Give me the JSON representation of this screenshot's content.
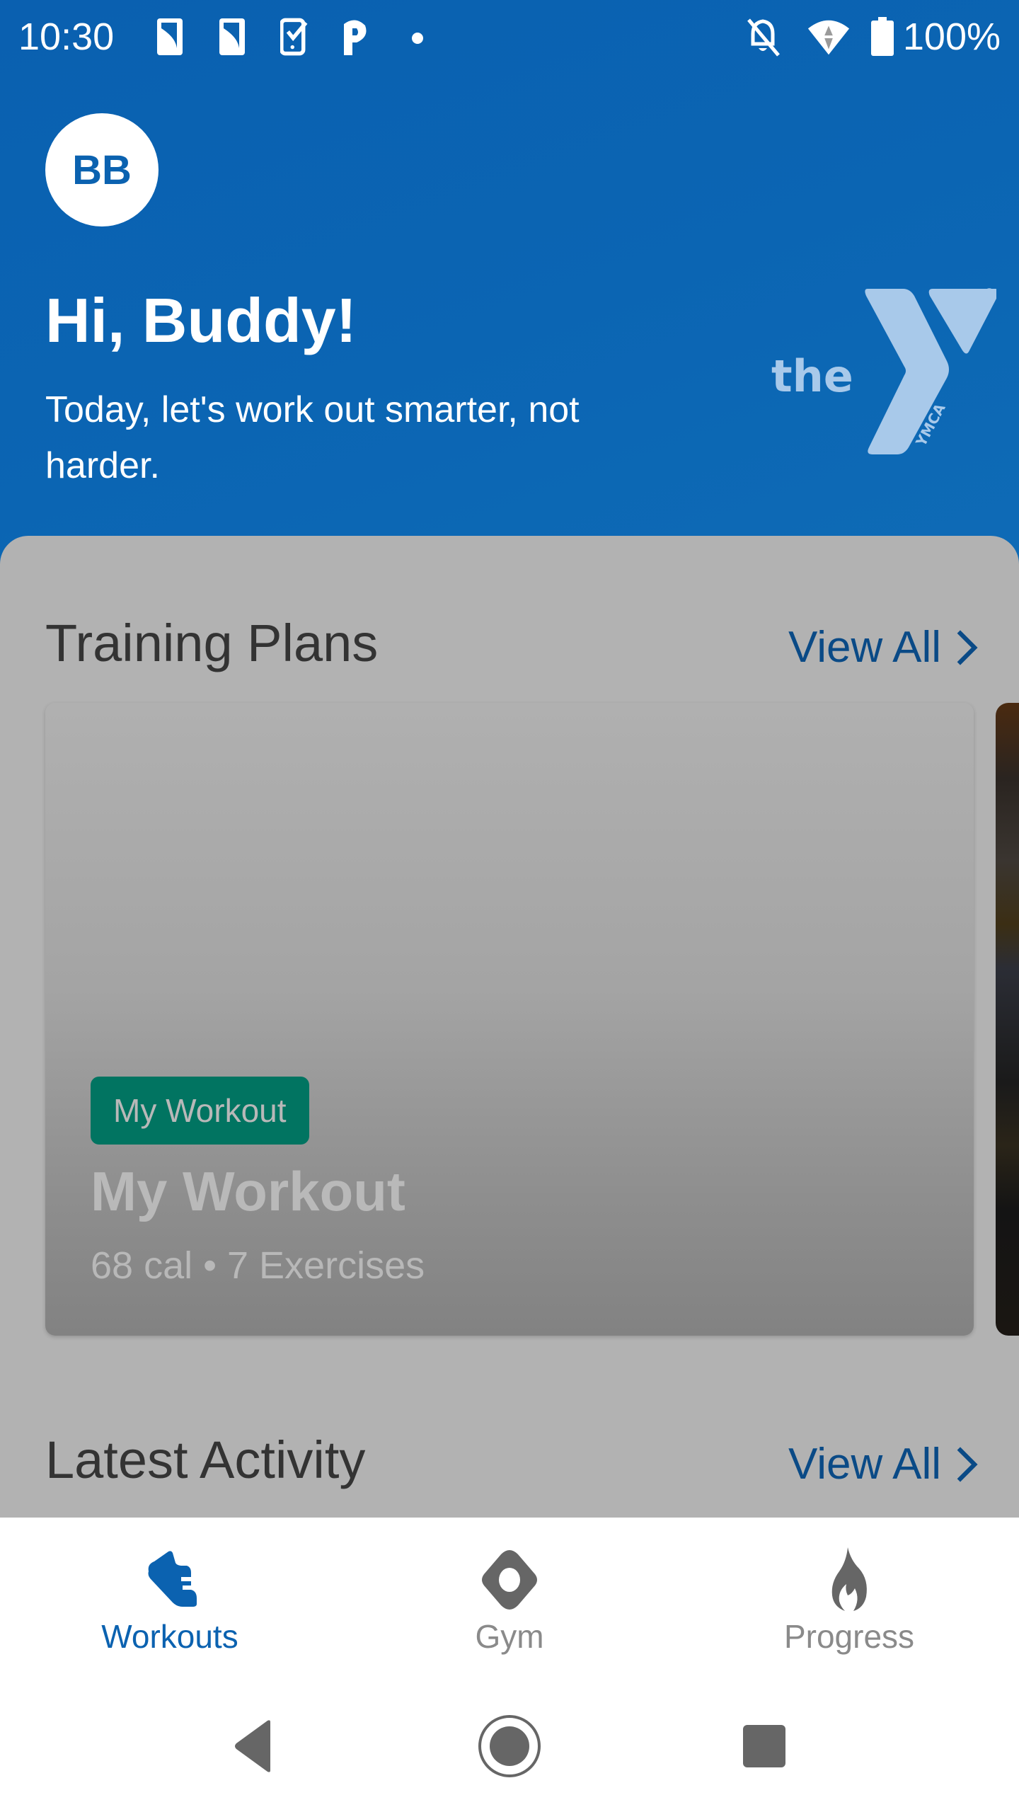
{
  "status_bar": {
    "time": "10:30",
    "left_icons": [
      "sim-card-icon",
      "sim-card-icon",
      "phone-check-icon",
      "parking-icon",
      "dot-icon"
    ],
    "right_icons": [
      "notifications-off-icon",
      "wifi-icon",
      "battery-full-icon"
    ],
    "battery_percent": "100%"
  },
  "header": {
    "avatar_initials": "BB",
    "greeting": "Hi, Buddy!",
    "subtitle": "Today, let's work out smarter, not harder.",
    "logo_text": "the",
    "logo_sub": "YMCA",
    "logo_mark": "®"
  },
  "training_plans": {
    "title": "Training Plans",
    "view_all": "View All",
    "cards": [
      {
        "badge": "My Workout",
        "title": "My Workout",
        "meta": "68 cal • 7 Exercises"
      }
    ]
  },
  "latest_activity": {
    "title": "Latest Activity",
    "view_all": "View All"
  },
  "bottom_nav": {
    "items": [
      {
        "label": "Workouts",
        "icon": "shoe-icon",
        "active": true
      },
      {
        "label": "Gym",
        "icon": "location-diamond-icon",
        "active": false
      },
      {
        "label": "Progress",
        "icon": "flame-icon",
        "active": false
      }
    ]
  },
  "system_nav": {
    "buttons": [
      "back",
      "home",
      "recents"
    ]
  },
  "colors": {
    "brand_blue": "#0b62b0",
    "link_blue": "#0a4a86",
    "badge_green": "#017461",
    "inactive_gray": "#666666",
    "sheet_gray": "#b2b2b2"
  }
}
